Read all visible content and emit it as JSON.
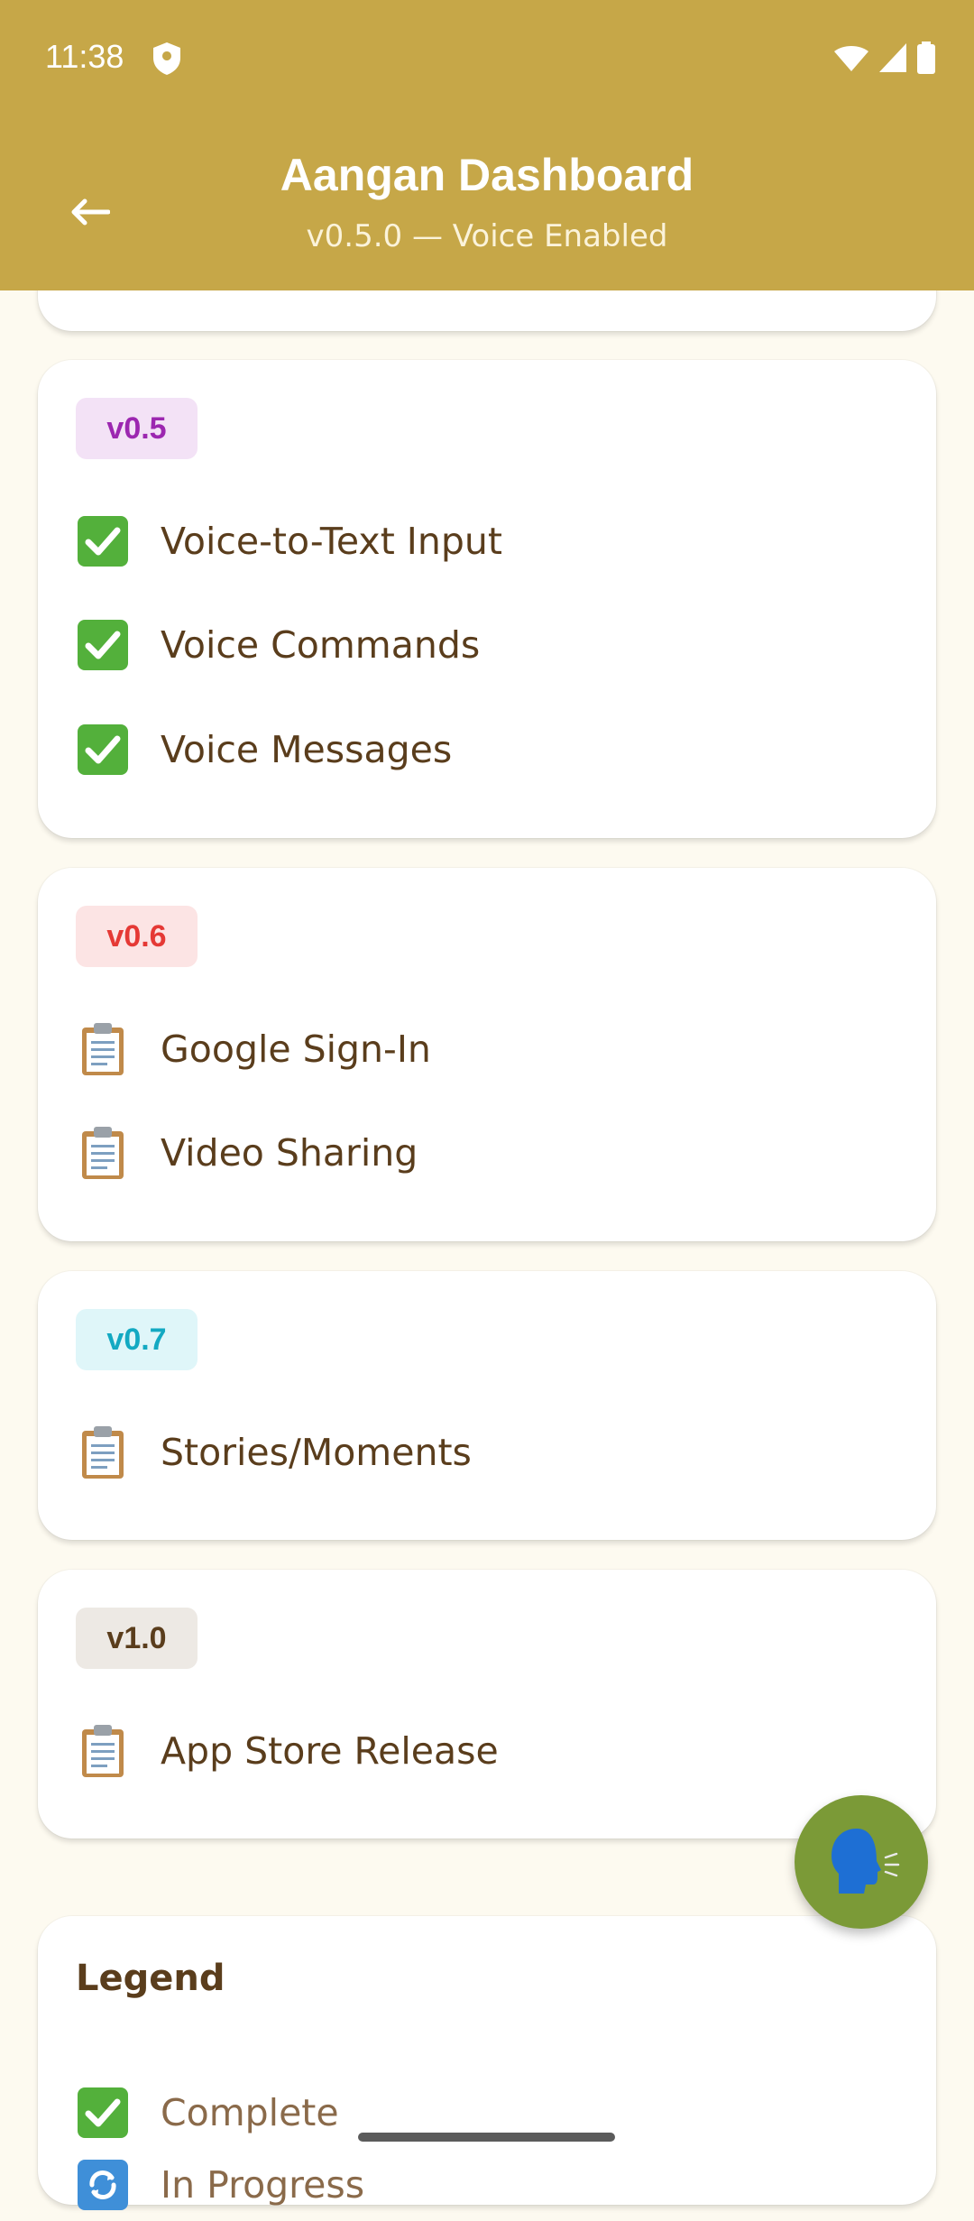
{
  "status_bar": {
    "time": "11:38"
  },
  "header": {
    "title": "Aangan Dashboard",
    "subtitle": "v0.5.0 — Voice Enabled"
  },
  "versions": [
    {
      "badge": "v0.5",
      "badge_color": "#9c27b0",
      "badge_bg": "#f3e2f6",
      "items": [
        {
          "icon": "check-icon",
          "label": "Voice-to-Text Input"
        },
        {
          "icon": "check-icon",
          "label": "Voice Commands"
        },
        {
          "icon": "check-icon",
          "label": "Voice Messages"
        }
      ]
    },
    {
      "badge": "v0.6",
      "badge_color": "#e53935",
      "badge_bg": "#fce4e4",
      "items": [
        {
          "icon": "clipboard-icon",
          "label": "Google Sign-In"
        },
        {
          "icon": "clipboard-icon",
          "label": "Video Sharing"
        }
      ]
    },
    {
      "badge": "v0.7",
      "badge_color": "#13a9c2",
      "badge_bg": "#dff6f9",
      "items": [
        {
          "icon": "clipboard-icon",
          "label": "Stories/Moments"
        }
      ]
    },
    {
      "badge": "v1.0",
      "badge_color": "#5a3d1c",
      "badge_bg": "#ede9e4",
      "items": [
        {
          "icon": "clipboard-icon",
          "label": "App Store Release"
        }
      ]
    }
  ],
  "legend": {
    "title": "Legend",
    "items": [
      {
        "icon": "check-icon",
        "label": "Complete"
      },
      {
        "icon": "refresh-icon",
        "label": "In Progress"
      }
    ]
  },
  "colors": {
    "header": "#c6a748",
    "fab": "#7b9a37",
    "text_primary": "#5a3d1c",
    "check": "#53b03b"
  }
}
